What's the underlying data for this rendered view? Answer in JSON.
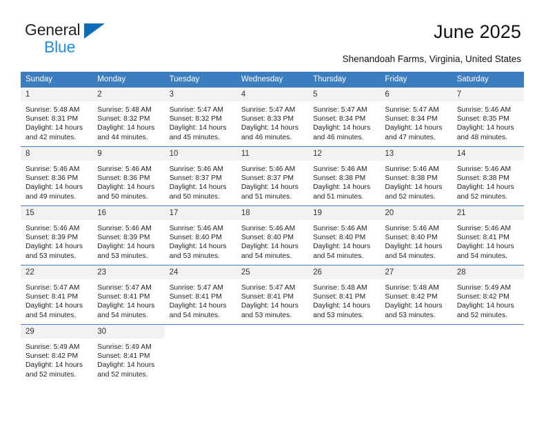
{
  "brand": {
    "name_top": "General",
    "name_bottom": "Blue"
  },
  "header": {
    "title": "June 2025",
    "location": "Shenandoah Farms, Virginia, United States"
  },
  "calendar": {
    "weekday_headers": [
      "Sunday",
      "Monday",
      "Tuesday",
      "Wednesday",
      "Thursday",
      "Friday",
      "Saturday"
    ],
    "colors": {
      "header_blue": "#3b7dbf",
      "daynum_band": "#f2f2f2",
      "brand_blue": "#1b8de4",
      "brand_triangle": "#0c6cb5"
    },
    "weeks": [
      [
        {
          "day": "1",
          "sunrise": "Sunrise: 5:48 AM",
          "sunset": "Sunset: 8:31 PM",
          "daylight1": "Daylight: 14 hours",
          "daylight2": "and 42 minutes."
        },
        {
          "day": "2",
          "sunrise": "Sunrise: 5:48 AM",
          "sunset": "Sunset: 8:32 PM",
          "daylight1": "Daylight: 14 hours",
          "daylight2": "and 44 minutes."
        },
        {
          "day": "3",
          "sunrise": "Sunrise: 5:47 AM",
          "sunset": "Sunset: 8:32 PM",
          "daylight1": "Daylight: 14 hours",
          "daylight2": "and 45 minutes."
        },
        {
          "day": "4",
          "sunrise": "Sunrise: 5:47 AM",
          "sunset": "Sunset: 8:33 PM",
          "daylight1": "Daylight: 14 hours",
          "daylight2": "and 46 minutes."
        },
        {
          "day": "5",
          "sunrise": "Sunrise: 5:47 AM",
          "sunset": "Sunset: 8:34 PM",
          "daylight1": "Daylight: 14 hours",
          "daylight2": "and 46 minutes."
        },
        {
          "day": "6",
          "sunrise": "Sunrise: 5:47 AM",
          "sunset": "Sunset: 8:34 PM",
          "daylight1": "Daylight: 14 hours",
          "daylight2": "and 47 minutes."
        },
        {
          "day": "7",
          "sunrise": "Sunrise: 5:46 AM",
          "sunset": "Sunset: 8:35 PM",
          "daylight1": "Daylight: 14 hours",
          "daylight2": "and 48 minutes."
        }
      ],
      [
        {
          "day": "8",
          "sunrise": "Sunrise: 5:46 AM",
          "sunset": "Sunset: 8:36 PM",
          "daylight1": "Daylight: 14 hours",
          "daylight2": "and 49 minutes."
        },
        {
          "day": "9",
          "sunrise": "Sunrise: 5:46 AM",
          "sunset": "Sunset: 8:36 PM",
          "daylight1": "Daylight: 14 hours",
          "daylight2": "and 50 minutes."
        },
        {
          "day": "10",
          "sunrise": "Sunrise: 5:46 AM",
          "sunset": "Sunset: 8:37 PM",
          "daylight1": "Daylight: 14 hours",
          "daylight2": "and 50 minutes."
        },
        {
          "day": "11",
          "sunrise": "Sunrise: 5:46 AM",
          "sunset": "Sunset: 8:37 PM",
          "daylight1": "Daylight: 14 hours",
          "daylight2": "and 51 minutes."
        },
        {
          "day": "12",
          "sunrise": "Sunrise: 5:46 AM",
          "sunset": "Sunset: 8:38 PM",
          "daylight1": "Daylight: 14 hours",
          "daylight2": "and 51 minutes."
        },
        {
          "day": "13",
          "sunrise": "Sunrise: 5:46 AM",
          "sunset": "Sunset: 8:38 PM",
          "daylight1": "Daylight: 14 hours",
          "daylight2": "and 52 minutes."
        },
        {
          "day": "14",
          "sunrise": "Sunrise: 5:46 AM",
          "sunset": "Sunset: 8:38 PM",
          "daylight1": "Daylight: 14 hours",
          "daylight2": "and 52 minutes."
        }
      ],
      [
        {
          "day": "15",
          "sunrise": "Sunrise: 5:46 AM",
          "sunset": "Sunset: 8:39 PM",
          "daylight1": "Daylight: 14 hours",
          "daylight2": "and 53 minutes."
        },
        {
          "day": "16",
          "sunrise": "Sunrise: 5:46 AM",
          "sunset": "Sunset: 8:39 PM",
          "daylight1": "Daylight: 14 hours",
          "daylight2": "and 53 minutes."
        },
        {
          "day": "17",
          "sunrise": "Sunrise: 5:46 AM",
          "sunset": "Sunset: 8:40 PM",
          "daylight1": "Daylight: 14 hours",
          "daylight2": "and 53 minutes."
        },
        {
          "day": "18",
          "sunrise": "Sunrise: 5:46 AM",
          "sunset": "Sunset: 8:40 PM",
          "daylight1": "Daylight: 14 hours",
          "daylight2": "and 54 minutes."
        },
        {
          "day": "19",
          "sunrise": "Sunrise: 5:46 AM",
          "sunset": "Sunset: 8:40 PM",
          "daylight1": "Daylight: 14 hours",
          "daylight2": "and 54 minutes."
        },
        {
          "day": "20",
          "sunrise": "Sunrise: 5:46 AM",
          "sunset": "Sunset: 8:40 PM",
          "daylight1": "Daylight: 14 hours",
          "daylight2": "and 54 minutes."
        },
        {
          "day": "21",
          "sunrise": "Sunrise: 5:46 AM",
          "sunset": "Sunset: 8:41 PM",
          "daylight1": "Daylight: 14 hours",
          "daylight2": "and 54 minutes."
        }
      ],
      [
        {
          "day": "22",
          "sunrise": "Sunrise: 5:47 AM",
          "sunset": "Sunset: 8:41 PM",
          "daylight1": "Daylight: 14 hours",
          "daylight2": "and 54 minutes."
        },
        {
          "day": "23",
          "sunrise": "Sunrise: 5:47 AM",
          "sunset": "Sunset: 8:41 PM",
          "daylight1": "Daylight: 14 hours",
          "daylight2": "and 54 minutes."
        },
        {
          "day": "24",
          "sunrise": "Sunrise: 5:47 AM",
          "sunset": "Sunset: 8:41 PM",
          "daylight1": "Daylight: 14 hours",
          "daylight2": "and 54 minutes."
        },
        {
          "day": "25",
          "sunrise": "Sunrise: 5:47 AM",
          "sunset": "Sunset: 8:41 PM",
          "daylight1": "Daylight: 14 hours",
          "daylight2": "and 53 minutes."
        },
        {
          "day": "26",
          "sunrise": "Sunrise: 5:48 AM",
          "sunset": "Sunset: 8:41 PM",
          "daylight1": "Daylight: 14 hours",
          "daylight2": "and 53 minutes."
        },
        {
          "day": "27",
          "sunrise": "Sunrise: 5:48 AM",
          "sunset": "Sunset: 8:42 PM",
          "daylight1": "Daylight: 14 hours",
          "daylight2": "and 53 minutes."
        },
        {
          "day": "28",
          "sunrise": "Sunrise: 5:49 AM",
          "sunset": "Sunset: 8:42 PM",
          "daylight1": "Daylight: 14 hours",
          "daylight2": "and 52 minutes."
        }
      ],
      [
        {
          "day": "29",
          "sunrise": "Sunrise: 5:49 AM",
          "sunset": "Sunset: 8:42 PM",
          "daylight1": "Daylight: 14 hours",
          "daylight2": "and 52 minutes."
        },
        {
          "day": "30",
          "sunrise": "Sunrise: 5:49 AM",
          "sunset": "Sunset: 8:41 PM",
          "daylight1": "Daylight: 14 hours",
          "daylight2": "and 52 minutes."
        },
        {
          "day": "",
          "sunrise": "",
          "sunset": "",
          "daylight1": "",
          "daylight2": ""
        },
        {
          "day": "",
          "sunrise": "",
          "sunset": "",
          "daylight1": "",
          "daylight2": ""
        },
        {
          "day": "",
          "sunrise": "",
          "sunset": "",
          "daylight1": "",
          "daylight2": ""
        },
        {
          "day": "",
          "sunrise": "",
          "sunset": "",
          "daylight1": "",
          "daylight2": ""
        },
        {
          "day": "",
          "sunrise": "",
          "sunset": "",
          "daylight1": "",
          "daylight2": ""
        }
      ]
    ]
  }
}
